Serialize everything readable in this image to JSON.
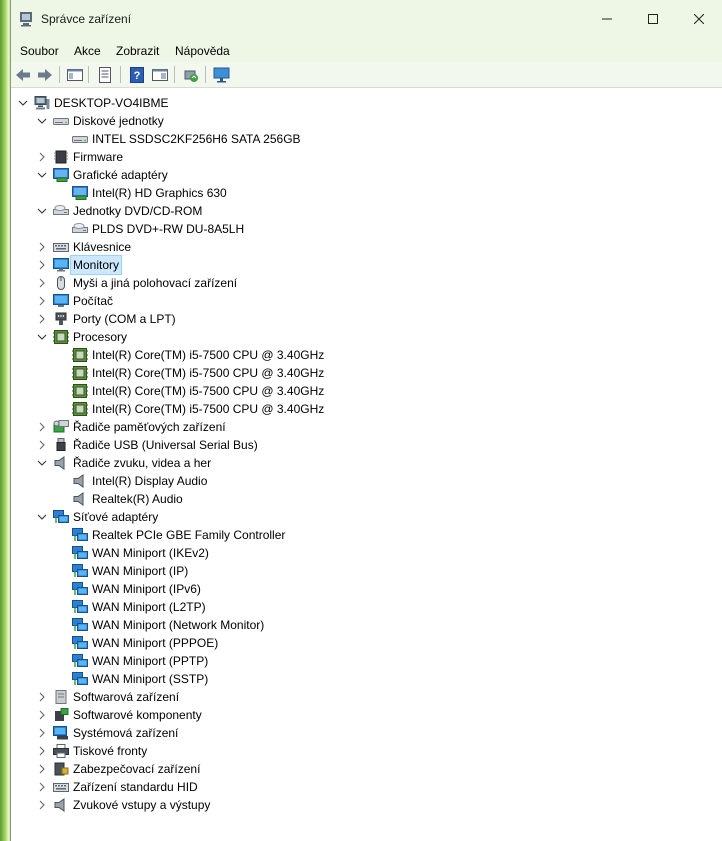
{
  "window": {
    "title": "Správce zařízení",
    "minimize_label": "—",
    "maximize_label": "☐",
    "close_label": "✕"
  },
  "menu": {
    "items": [
      "Soubor",
      "Akce",
      "Zobrazit",
      "Nápověda"
    ]
  },
  "toolbar": {
    "buttons": [
      "back-icon",
      "forward-icon",
      "show-hide-console-tree-icon",
      "properties-icon",
      "help-icon",
      "action-pane-icon",
      "update-driver-icon",
      "scan-hardware-icon"
    ]
  },
  "tree": {
    "root": "DESKTOP-VO4IBME",
    "nodes": [
      {
        "label": "Diskové jednotky",
        "expanded": true,
        "icon": "disk-icon",
        "children": [
          "INTEL SSDSC2KF256H6 SATA 256GB"
        ]
      },
      {
        "label": "Firmware",
        "expanded": false,
        "icon": "firmware-icon"
      },
      {
        "label": "Grafické adaptéry",
        "expanded": true,
        "icon": "display-adapter-icon",
        "children": [
          "Intel(R) HD Graphics 630"
        ]
      },
      {
        "label": "Jednotky DVD/CD-ROM",
        "expanded": true,
        "icon": "dvd-icon",
        "children": [
          "PLDS DVD+-RW DU-8A5LH"
        ]
      },
      {
        "label": "Klávesnice",
        "expanded": false,
        "icon": "keyboard-icon"
      },
      {
        "label": "Monitory",
        "expanded": false,
        "icon": "monitor-icon",
        "selected": true
      },
      {
        "label": "Myši a jiná polohovací zařízení",
        "expanded": false,
        "icon": "mouse-icon"
      },
      {
        "label": "Počítač",
        "expanded": false,
        "icon": "computer-icon"
      },
      {
        "label": "Porty (COM a LPT)",
        "expanded": false,
        "icon": "port-icon"
      },
      {
        "label": "Procesory",
        "expanded": true,
        "icon": "processor-icon",
        "children": [
          "Intel(R) Core(TM) i5-7500 CPU @ 3.40GHz",
          "Intel(R) Core(TM) i5-7500 CPU @ 3.40GHz",
          "Intel(R) Core(TM) i5-7500 CPU @ 3.40GHz",
          "Intel(R) Core(TM) i5-7500 CPU @ 3.40GHz"
        ]
      },
      {
        "label": "Řadiče paměťových zařízení",
        "expanded": false,
        "icon": "storage-controller-icon"
      },
      {
        "label": "Řadiče USB (Universal Serial Bus)",
        "expanded": false,
        "icon": "usb-icon"
      },
      {
        "label": "Řadiče zvuku, videa a her",
        "expanded": true,
        "icon": "speaker-icon",
        "children": [
          "Intel(R) Display Audio",
          "Realtek(R) Audio"
        ]
      },
      {
        "label": "Síťové adaptéry",
        "expanded": true,
        "icon": "network-icon",
        "children": [
          "Realtek PCIe GBE Family Controller",
          "WAN Miniport (IKEv2)",
          "WAN Miniport (IP)",
          "WAN Miniport (IPv6)",
          "WAN Miniport (L2TP)",
          "WAN Miniport (Network Monitor)",
          "WAN Miniport (PPPOE)",
          "WAN Miniport (PPTP)",
          "WAN Miniport (SSTP)"
        ]
      },
      {
        "label": "Softwarová zařízení",
        "expanded": false,
        "icon": "software-device-icon"
      },
      {
        "label": "Softwarové komponenty",
        "expanded": false,
        "icon": "software-component-icon"
      },
      {
        "label": "Systémová zařízení",
        "expanded": false,
        "icon": "system-device-icon"
      },
      {
        "label": "Tiskové fronty",
        "expanded": false,
        "icon": "printer-icon"
      },
      {
        "label": "Zabezpečovací zařízení",
        "expanded": false,
        "icon": "security-device-icon"
      },
      {
        "label": "Zařízení standardu HID",
        "expanded": false,
        "icon": "hid-icon"
      },
      {
        "label": "Zvukové vstupy a výstupy",
        "expanded": false,
        "icon": "audio-io-icon"
      }
    ]
  },
  "colors": {
    "selection_bg": "#cce8ff",
    "selection_border": "#99d1ff",
    "titlebar_bg": "#eef7e6"
  }
}
